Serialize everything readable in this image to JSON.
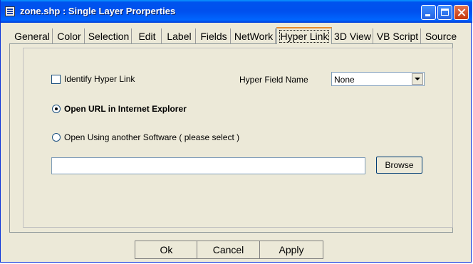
{
  "window": {
    "title": "zone.shp  : Single Layer Prorperties"
  },
  "tabs": [
    {
      "label": "General"
    },
    {
      "label": "Color"
    },
    {
      "label": "Selection"
    },
    {
      "label": "Edit"
    },
    {
      "label": "Label"
    },
    {
      "label": "Fields"
    },
    {
      "label": "NetWork"
    },
    {
      "label": "Hyper Link"
    },
    {
      "label": "3D View"
    },
    {
      "label": "VB Script"
    },
    {
      "label": "Source"
    }
  ],
  "active_tab": "Hyper Link",
  "hyperlink": {
    "identify_label": "Identify Hyper Link",
    "identify_checked": false,
    "field_name_label": "Hyper Field Name",
    "field_name_value": "None",
    "option_ie_label": "Open URL in Internet Explorer",
    "option_ie_selected": true,
    "option_other_label": "Open Using another Software ( please select )",
    "option_other_selected": false,
    "software_path_value": "",
    "browse_label": "Browse"
  },
  "footer": {
    "ok_label": "Ok",
    "cancel_label": "Cancel",
    "apply_label": "Apply"
  }
}
